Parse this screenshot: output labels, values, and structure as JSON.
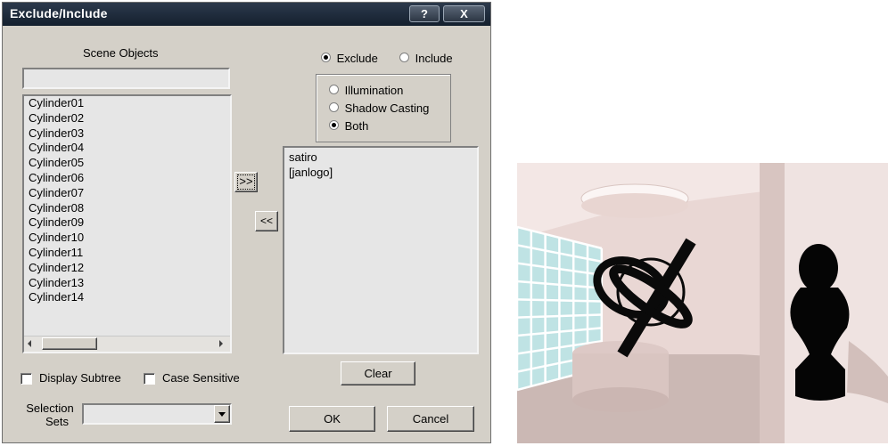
{
  "dialog": {
    "title": "Exclude/Include",
    "help_label": "?",
    "close_label": "X",
    "scene_objects_label": "Scene Objects",
    "search_value": "",
    "scene_objects": [
      "Cylinder01",
      "Cylinder02",
      "Cylinder03",
      "Cylinder04",
      "Cylinder05",
      "Cylinder06",
      "Cylinder07",
      "Cylinder08",
      "Cylinder09",
      "Cylinder10",
      "Cylinder11",
      "Cylinder12",
      "Cylinder13",
      "Cylinder14"
    ],
    "add_label": ">>",
    "remove_label": "<<",
    "mode_options": [
      {
        "label": "Exclude",
        "selected": true
      },
      {
        "label": "Include",
        "selected": false
      }
    ],
    "type_options": [
      {
        "label": "Illumination",
        "selected": false
      },
      {
        "label": "Shadow Casting",
        "selected": false
      },
      {
        "label": "Both",
        "selected": true
      }
    ],
    "excluded_items": [
      "satiro",
      "[janlogo]"
    ],
    "clear_label": "Clear",
    "display_subtree_label": "Display Subtree",
    "case_sensitive_label": "Case Sensitive",
    "selection_sets_label_line1": "Selection",
    "selection_sets_label_line2": "Sets",
    "selection_sets_value": "",
    "ok_label": "OK",
    "cancel_label": "Cancel"
  },
  "colors": {
    "dialog_bg": "#d4d0c8",
    "titlebar": "#1e2a3a",
    "render_wall": "#e9d6d3",
    "render_floor": "#c9b6b2",
    "glass_block": "#cfeaea",
    "silhouette": "#0a0a0a"
  }
}
